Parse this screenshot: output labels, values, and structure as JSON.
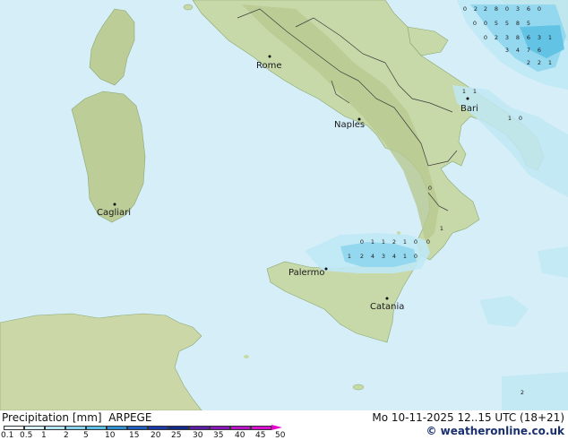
{
  "map": {
    "colors": {
      "sea": "#d6eef8",
      "land": "#c7d9a8",
      "land_high": "#b8c890",
      "border": "#3a3a3a",
      "precip_light": "#bfe8f5",
      "precip_mid": "#8fd6ee",
      "precip_heavy": "#5bbfe3"
    },
    "cities": [
      {
        "name": "Rome",
        "id": "rome"
      },
      {
        "name": "Naples",
        "id": "naples"
      },
      {
        "name": "Bari",
        "id": "bari"
      },
      {
        "name": "Cagliari",
        "id": "cagliari"
      },
      {
        "name": "Palermo",
        "id": "palermo"
      },
      {
        "name": "Catania",
        "id": "catania"
      }
    ],
    "precip_values": [
      "0",
      "2",
      "2",
      "8",
      "0",
      "3",
      "6",
      "0",
      "0",
      "0",
      "5",
      "5",
      "8",
      "5",
      "0",
      "2",
      "3",
      "8",
      "6",
      "3",
      "1",
      "3",
      "4",
      "7",
      "6",
      "2",
      "2",
      "1",
      "1",
      "1",
      "1",
      "0",
      "0",
      "1",
      "0",
      "1",
      "1",
      "2",
      "1",
      "0",
      "0",
      "1",
      "2",
      "4",
      "3",
      "4",
      "1",
      "0",
      "2"
    ]
  },
  "footer": {
    "title": "Precipitation [mm]  ARPEGE",
    "datetime": "Mo 10-11-2025 12..15 UTC (18+21)",
    "credit": "© weatheronline.co.uk",
    "legend_ticks": [
      "0.1",
      "0.5",
      "1",
      "2",
      "5",
      "10",
      "15",
      "20",
      "25",
      "30",
      "35",
      "40",
      "45",
      "50"
    ],
    "legend_colors": [
      "#f2fbfe",
      "#d8f2fb",
      "#b4e6f6",
      "#88d4ef",
      "#5cc0e6",
      "#2f8fd3",
      "#1e5fc0",
      "#1a3aa8",
      "#122a8a",
      "#5a1ea8",
      "#8a18b8",
      "#b814c8",
      "#d810d0"
    ]
  }
}
